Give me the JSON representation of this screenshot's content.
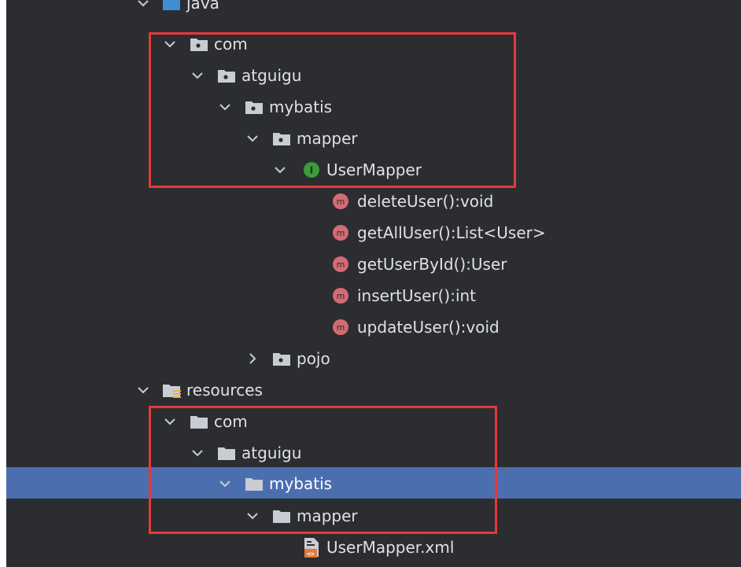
{
  "tree": {
    "java": "java",
    "com_java": "com",
    "atguigu_java": "atguigu",
    "mybatis_java": "mybatis",
    "mapper_java": "mapper",
    "usermapper": "UserMapper",
    "methods": [
      "deleteUser():void",
      "getAllUser():List<User>",
      "getUserById():User",
      "insertUser():int",
      "updateUser():void"
    ],
    "pojo": "pojo",
    "resources": "resources",
    "com_res": "com",
    "atguigu_res": "atguigu",
    "mybatis_res": "mybatis",
    "mapper_res": "mapper",
    "usermapper_xml": "UserMapper.xml"
  },
  "colors": {
    "background": "#2b2d30",
    "selection": "#4b6eaf",
    "highlight_box": "#e5393a",
    "folder": "#c9ccd2",
    "source_folder": "#3d8fd1",
    "interface_badge": "#3b9b3b",
    "method_badge": "#d36b74"
  },
  "icons": {
    "expanded": "chevron-down-icon",
    "collapsed": "chevron-right-icon",
    "folder": "folder-icon",
    "package": "package-icon",
    "source_root": "source-root-folder-icon",
    "resources_root": "resources-root-folder-icon",
    "interface": "interface-icon",
    "method": "method-icon",
    "xml": "xml-file-icon"
  }
}
